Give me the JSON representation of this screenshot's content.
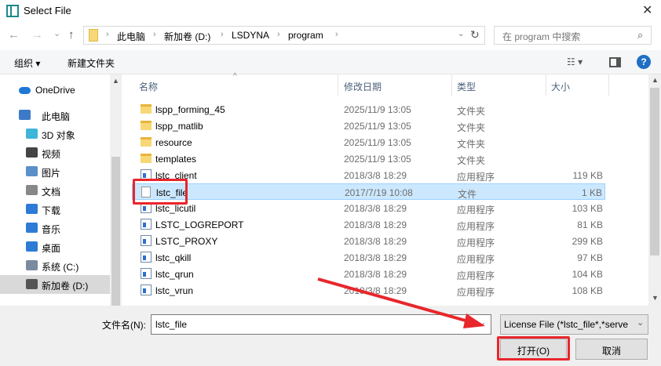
{
  "window": {
    "title": "Select File",
    "close": "✕"
  },
  "nav": {
    "back": "←",
    "forward": "→",
    "recent": "⌄",
    "up": "↑",
    "refresh": "↻"
  },
  "breadcrumb": [
    "此电脑",
    "新加卷 (D:)",
    "LSDYNA",
    "program"
  ],
  "search": {
    "placeholder": "在 program 中搜索"
  },
  "toolbar": {
    "organize": "组织 ▾",
    "new_folder": "新建文件夹"
  },
  "sidebar": [
    {
      "label": "OneDrive",
      "color": "#1e78d4"
    },
    {
      "label": "此电脑",
      "color": "#3c7ac8"
    },
    {
      "label": "3D 对象",
      "color": "#3fb5d9"
    },
    {
      "label": "视频",
      "color": "#444"
    },
    {
      "label": "图片",
      "color": "#5b8fc9"
    },
    {
      "label": "文档",
      "color": "#888"
    },
    {
      "label": "下载",
      "color": "#2d7bd6"
    },
    {
      "label": "音乐",
      "color": "#2d7bd6"
    },
    {
      "label": "桌面",
      "color": "#2d7bd6"
    },
    {
      "label": "系统 (C:)",
      "color": "#7a8aa0"
    },
    {
      "label": "新加卷 (D:)",
      "color": "#555",
      "selected": true
    }
  ],
  "columns": {
    "name": "名称",
    "date": "修改日期",
    "type": "类型",
    "size": "大小"
  },
  "files": [
    {
      "name": "lspp_forming_45",
      "date": "2025/11/9 13:05",
      "type": "文件夹",
      "size": "",
      "icon": "folder"
    },
    {
      "name": "lspp_matlib",
      "date": "2025/11/9 13:05",
      "type": "文件夹",
      "size": "",
      "icon": "folder"
    },
    {
      "name": "resource",
      "date": "2025/11/9 13:05",
      "type": "文件夹",
      "size": "",
      "icon": "folder"
    },
    {
      "name": "templates",
      "date": "2025/11/9 13:05",
      "type": "文件夹",
      "size": "",
      "icon": "folder"
    },
    {
      "name": "lstc_client",
      "date": "2018/3/8 18:29",
      "type": "应用程序",
      "size": "119 KB",
      "icon": "app"
    },
    {
      "name": "lstc_file",
      "date": "2017/7/19 10:08",
      "type": "文件",
      "size": "1 KB",
      "icon": "doc",
      "selected": true
    },
    {
      "name": "lstc_licutil",
      "date": "2018/3/8 18:29",
      "type": "应用程序",
      "size": "103 KB",
      "icon": "app"
    },
    {
      "name": "LSTC_LOGREPORT",
      "date": "2018/3/8 18:29",
      "type": "应用程序",
      "size": "81 KB",
      "icon": "app"
    },
    {
      "name": "LSTC_PROXY",
      "date": "2018/3/8 18:29",
      "type": "应用程序",
      "size": "299 KB",
      "icon": "app"
    },
    {
      "name": "lstc_qkill",
      "date": "2018/3/8 18:29",
      "type": "应用程序",
      "size": "97 KB",
      "icon": "app"
    },
    {
      "name": "lstc_qrun",
      "date": "2018/3/8 18:29",
      "type": "应用程序",
      "size": "104 KB",
      "icon": "app"
    },
    {
      "name": "lstc_vrun",
      "date": "2018/3/8 18:29",
      "type": "应用程序",
      "size": "108 KB",
      "icon": "app"
    }
  ],
  "footer": {
    "filename_label": "文件名(N):",
    "filename_value": "lstc_file",
    "filter": "License File (*lstc_file*,*serve",
    "open": "打开(O)",
    "cancel": "取消"
  },
  "accent": "#e8262b"
}
